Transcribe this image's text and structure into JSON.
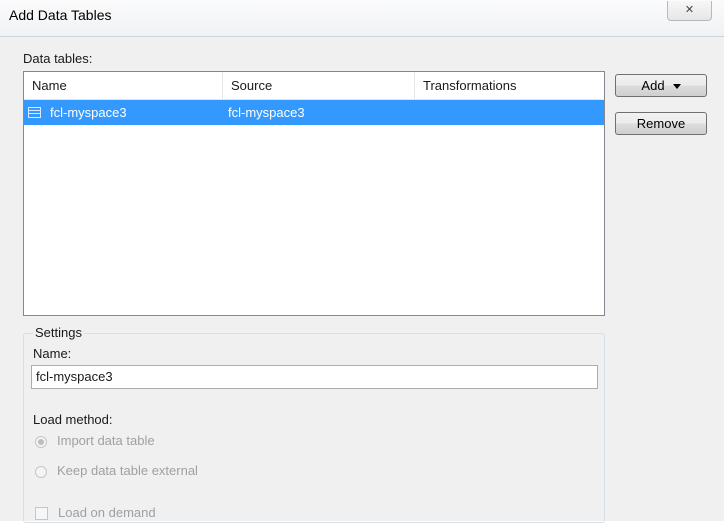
{
  "window": {
    "title": "Add Data Tables",
    "close_glyph": "✕"
  },
  "data_tables": {
    "label": "Data tables:",
    "columns": [
      "Name",
      "Source",
      "Transformations"
    ],
    "rows": [
      {
        "name": "fcl-myspace3",
        "source": "fcl-myspace3",
        "transformations": "",
        "selected": true,
        "icon": "table-icon"
      }
    ]
  },
  "buttons": {
    "add": "Add",
    "remove": "Remove"
  },
  "settings": {
    "group_label": "Settings",
    "name_label": "Name:",
    "name_value": "fcl-myspace3",
    "load_method_label": "Load method:",
    "load_options": [
      {
        "label": "Import data table",
        "checked": true,
        "enabled": false
      },
      {
        "label": "Keep data table external",
        "checked": false,
        "enabled": false
      }
    ],
    "load_on_demand": {
      "label": "Load on demand",
      "checked": false,
      "enabled": false
    }
  },
  "colors": {
    "selection": "#3399ff",
    "dialog_bg": "#f0f0f0"
  }
}
